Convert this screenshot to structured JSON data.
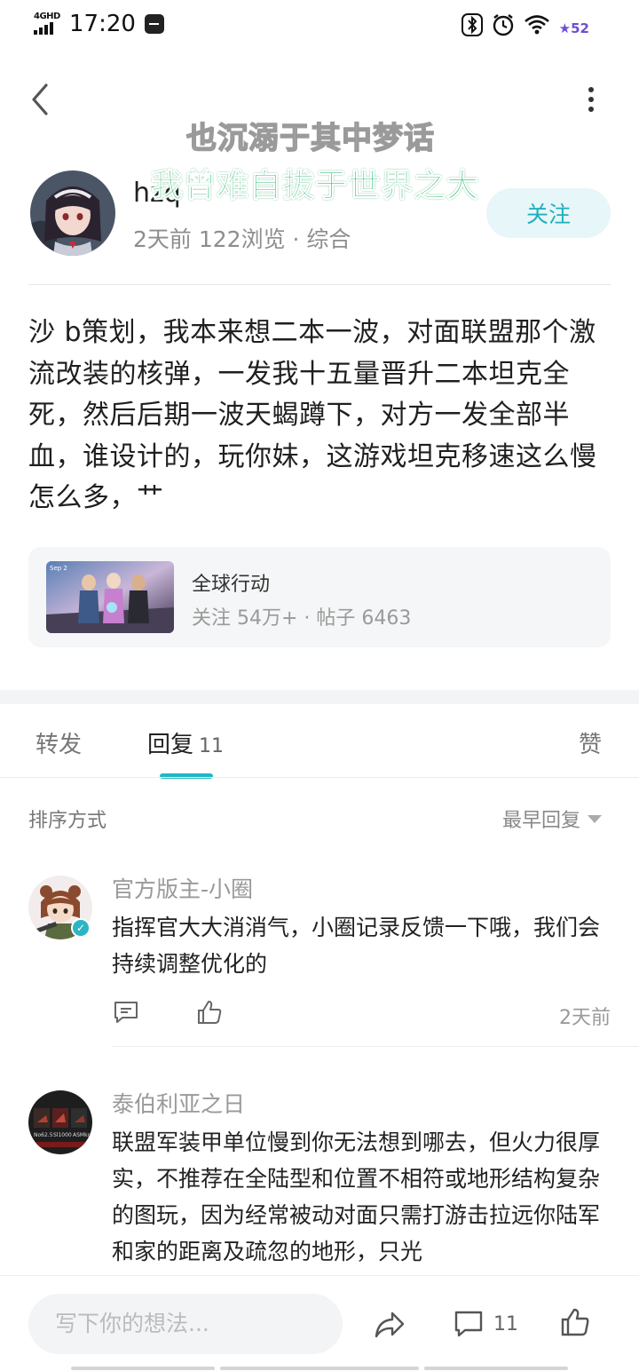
{
  "status_bar": {
    "network": "4GHD",
    "time": "17:20",
    "battery": "52"
  },
  "header": {
    "back_icon": "chevron-left-icon",
    "more_icon": "more-vertical-icon"
  },
  "overlay_danmaku": [
    "也沉溺于其中梦话",
    "我曾难自拔于世界之大"
  ],
  "author": {
    "name": "hzq",
    "meta": "2天前  122浏览  ·  综合",
    "follow_label": "关注"
  },
  "post": {
    "body": "沙 b策划，我本来想二本一波，对面联盟那个激流改装的核弹，一发我十五量晋升二本坦克全死，然后后期一波天蝎蹲下，对方一发全部半血，谁设计的，玩你妹，这游戏坦克移速这么慢怎么多，艹"
  },
  "circle": {
    "name": "全球行动",
    "stats": "关注 54万+  ·  帖子 6463",
    "thumb_caption": "Sep 2"
  },
  "tabs": {
    "forward": "转发",
    "reply": "回复",
    "reply_count": "11",
    "like": "赞"
  },
  "sort": {
    "label": "排序方式",
    "selected": "最早回复"
  },
  "comments": [
    {
      "name": "官方版主-小圈",
      "text": "指挥官大大消消气，小圈记录反馈一下哦，我们会持续调整优化的",
      "time": "2天前"
    },
    {
      "name": "泰伯利亚之日",
      "text": "联盟军装甲单位慢到你无法想到哪去，但火力很厚实，不推荐在全陆型和位置不相符或地形结构复杂的图玩，因为经常被动对面只需打游击拉远你陆军和家的距离及疏忽的地形，只光",
      "avatar_labels": [
        "No62.5",
        "Sl1000",
        "ASMkr"
      ]
    }
  ],
  "bottom_bar": {
    "placeholder": "写下你的想法...",
    "comment_count": "11"
  },
  "colors": {
    "accent": "#22b6c3",
    "follow_bg": "#e7f6f8",
    "danmaku_green": "#37c27d"
  }
}
